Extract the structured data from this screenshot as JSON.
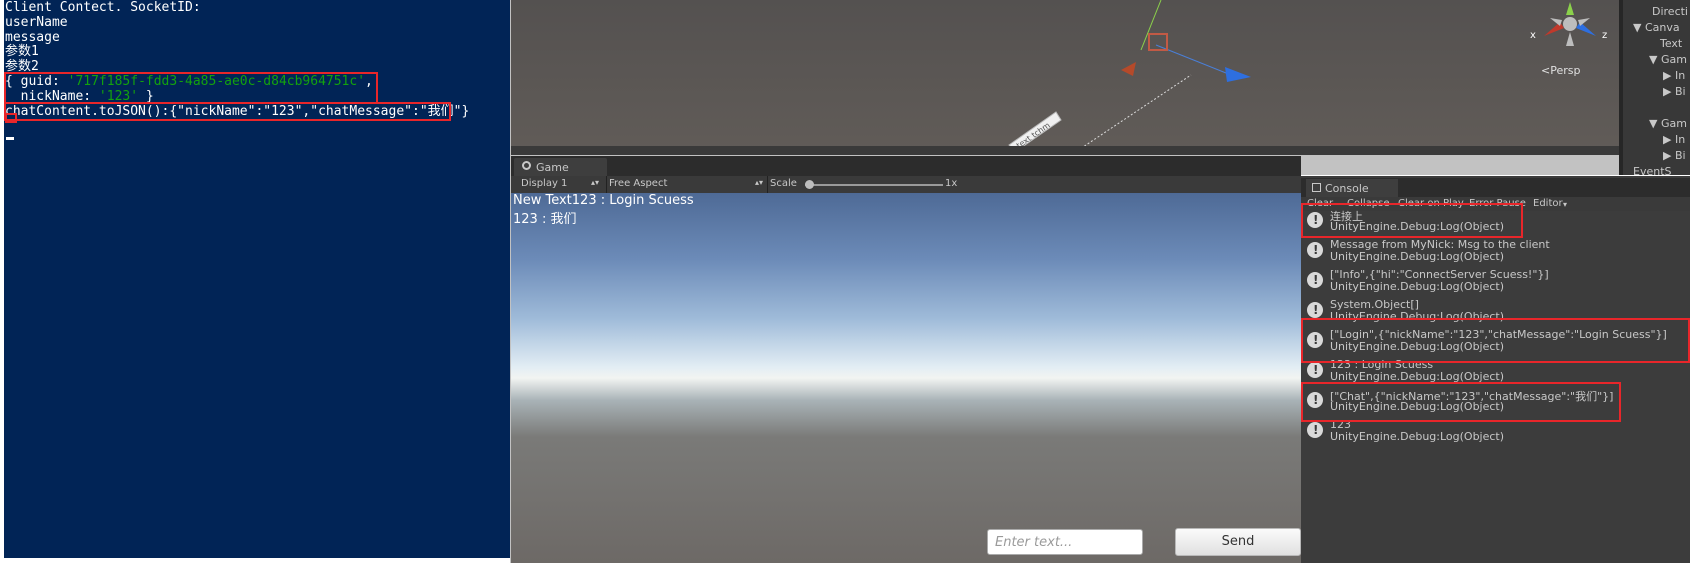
{
  "terminal": {
    "lines": [
      "Client Contect. SocketID:",
      "userName",
      "message",
      "参数1",
      "参数2"
    ],
    "guid_prefix": "{ guid: ",
    "guid_value": "'717f185f-fdd3-4a85-ae0c-d84cb964751c'",
    "guid_suffix": ",",
    "nick_prefix": "  nickName: ",
    "nick_value": "'123'",
    "nick_suffix": " }",
    "json_line": "chatContent.toJSON():{\"nickName\":\"123\",\"chatMessage\":\"我们\"}"
  },
  "scene": {
    "persp_label": "<Persp",
    "gizmo_x": "x",
    "gizmo_z": "z",
    "canvas_label": "text tchm"
  },
  "hierarchy": {
    "items": [
      "Directi",
      "Canva",
      "Text",
      "Gam",
      "In",
      "Bi",
      "Gam",
      "In",
      "Bi",
      "EventS"
    ]
  },
  "game": {
    "tab_label": "Game",
    "display": "Display 1",
    "aspect": "Free Aspect",
    "scale_label": "Scale",
    "scale_value": "1x",
    "text_line1": "New Text123 : Login Scuess",
    "text_line2": "123 : 我们",
    "input_placeholder": "Enter text...",
    "send_label": "Send"
  },
  "console": {
    "tab_label": "Console",
    "toolbar": [
      "Clear",
      "Collapse",
      "Clear on Play",
      "Error Pause",
      "Editor"
    ],
    "entries": [
      {
        "line1": "连接上",
        "line2": "UnityEngine.Debug:Log(Object)"
      },
      {
        "line1": "Message from MyNick: Msg to the client",
        "line2": "UnityEngine.Debug:Log(Object)"
      },
      {
        "line1": "[\"Info\",{\"hi\":\"ConnectServer Scuess!\"}]",
        "line2": "UnityEngine.Debug:Log(Object)"
      },
      {
        "line1": "System.Object[]",
        "line2": "UnityEngine.Debug:Log(Object)"
      },
      {
        "line1": "[\"Login\",{\"nickName\":\"123\",\"chatMessage\":\"Login Scuess\"}]",
        "line2": "UnityEngine.Debug:Log(Object)"
      },
      {
        "line1": "123 : Login Scuess",
        "line2": "UnityEngine.Debug:Log(Object)"
      },
      {
        "line1": "[\"Chat\",{\"nickName\":\"123\",\"chatMessage\":\"我们\"}]",
        "line2": "UnityEngine.Debug:Log(Object)"
      },
      {
        "line1": "123",
        "line2": "UnityEngine.Debug:Log(Object)"
      }
    ]
  }
}
